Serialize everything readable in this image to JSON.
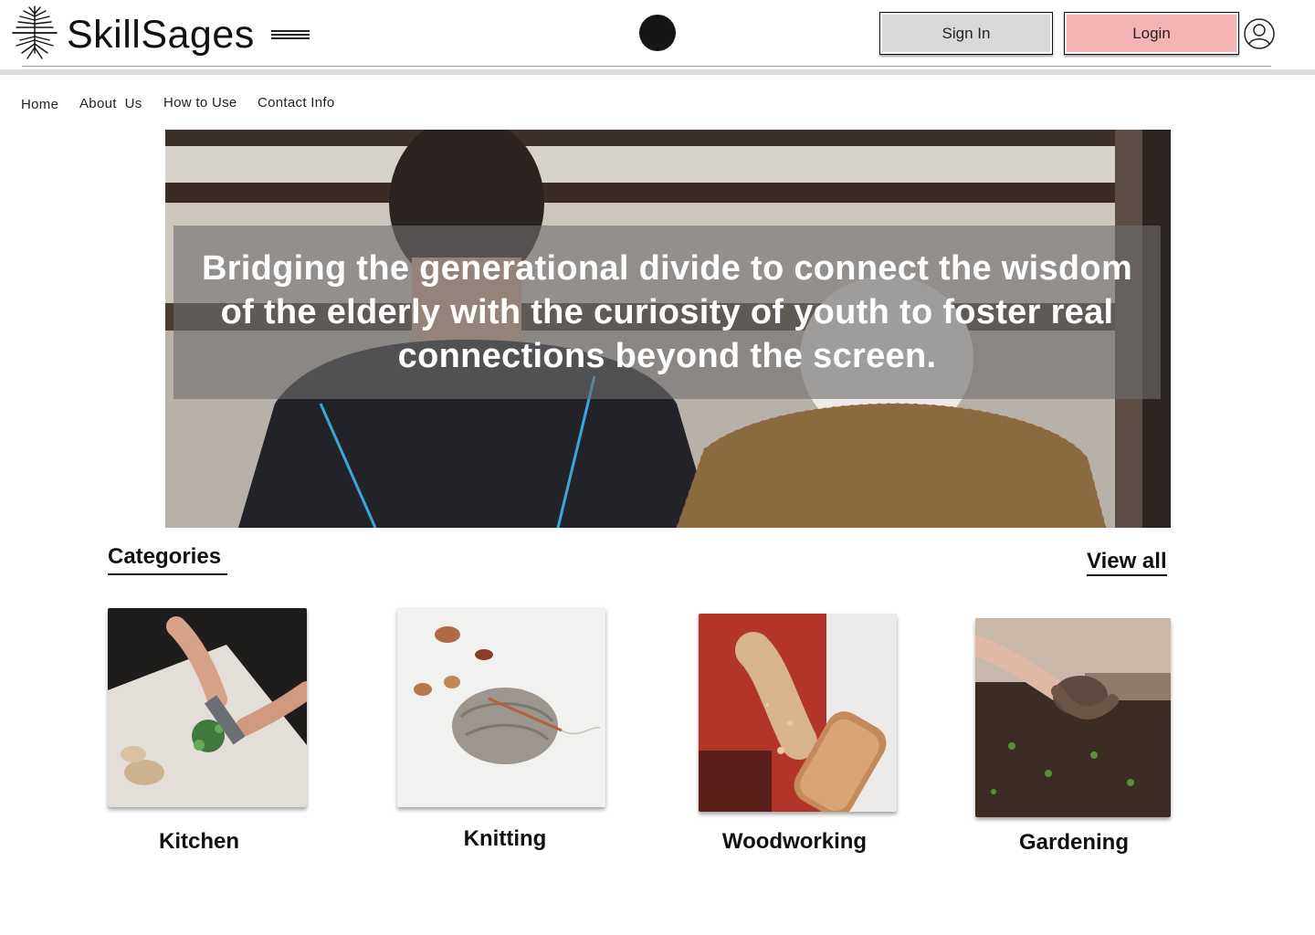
{
  "header": {
    "brand": "SkillSages",
    "signin_label": "Sign In",
    "login_label": "Login",
    "colors": {
      "signin_bg": "#d9d9d9",
      "login_bg": "#f6b3b5"
    }
  },
  "nav": {
    "items": [
      {
        "label": "Home"
      },
      {
        "label": "About  Us"
      },
      {
        "label": "How to Use"
      },
      {
        "label": "Contact Info"
      }
    ]
  },
  "hero": {
    "text": "Bridging the generational divide to connect the wisdom of the elderly with the curiosity of youth to foster real connections beyond the screen."
  },
  "categories": {
    "title": "Categories",
    "view_all": "View all",
    "items": [
      {
        "label": "Kitchen"
      },
      {
        "label": "Knitting"
      },
      {
        "label": "Woodworking"
      },
      {
        "label": "Gardening"
      }
    ]
  }
}
